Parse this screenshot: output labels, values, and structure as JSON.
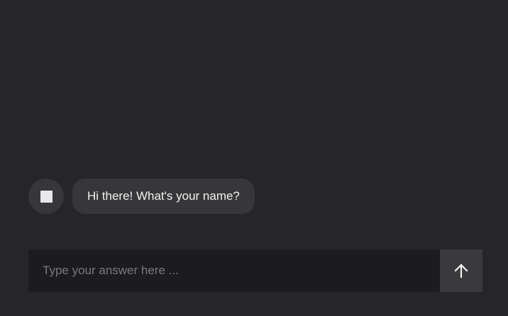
{
  "chat": {
    "messages": [
      {
        "sender": "bot",
        "avatar_icon": "square-icon",
        "text": "Hi there! What's your name?"
      }
    ]
  },
  "composer": {
    "placeholder": "Type your answer here ...",
    "value": "",
    "send_icon": "arrow-up-icon"
  },
  "colors": {
    "background": "#262628",
    "bubble": "#37373a",
    "input_background": "#1c1c1e",
    "send_button": "#3a3a3d",
    "text": "#f2f2f2",
    "placeholder": "#7a7a7e"
  }
}
